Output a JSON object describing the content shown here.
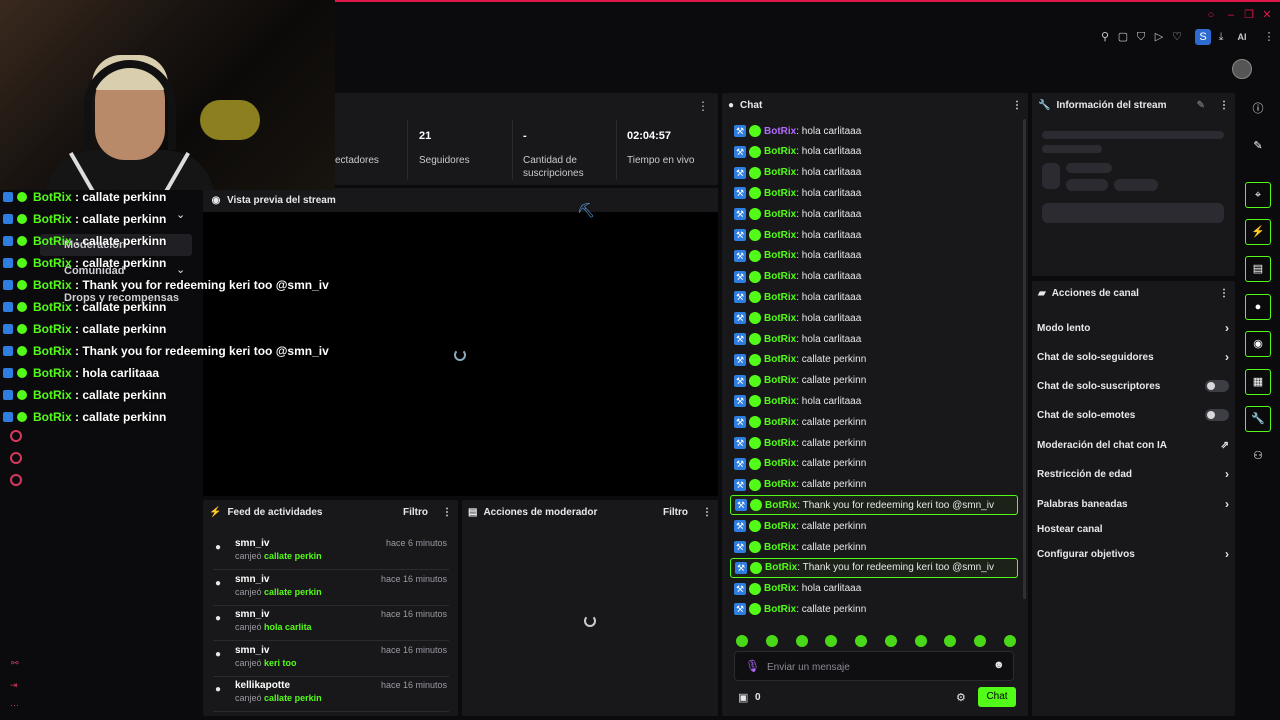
{
  "overlay_chat": [
    {
      "user": "BotRix",
      "text": "callate perkinn"
    },
    {
      "user": "BotRix",
      "text": "callate perkinn"
    },
    {
      "user": "BotRix",
      "text": "callate perkinn"
    },
    {
      "user": "BotRix",
      "text": "callate perkinn"
    },
    {
      "user": "BotRix",
      "text": "Thank you for redeeming keri too @smn_iv"
    },
    {
      "user": "BotRix",
      "text": "callate perkinn"
    },
    {
      "user": "BotRix",
      "text": "callate perkinn"
    },
    {
      "user": "BotRix",
      "text": "Thank you for redeeming keri too @smn_iv"
    },
    {
      "user": "BotRix",
      "text": "hola carlitaaa"
    },
    {
      "user": "BotRix",
      "text": "callate perkinn"
    },
    {
      "user": "BotRix",
      "text": "callate perkinn"
    }
  ],
  "leftnav": {
    "moderation": "Moderación",
    "community": "Comunidad",
    "drops": "Drops y recompensas"
  },
  "stats": {
    "viewers_label": "ectadores",
    "followers_value": "21",
    "followers_label": "Seguidores",
    "subs_value": "-",
    "subs_label": "Cantidad de suscripciones",
    "uptime_value": "02:04:57",
    "uptime_label": "Tiempo en vivo"
  },
  "preview": {
    "title": "Vista previa del stream"
  },
  "feed": {
    "title": "Feed de actividades",
    "filter": "Filtro",
    "items": [
      {
        "user": "smn_iv",
        "time": "hace 6 minutos",
        "verb": "canjeó",
        "reward": "callate perkin"
      },
      {
        "user": "smn_iv",
        "time": "hace 16 minutos",
        "verb": "canjeó",
        "reward": "callate perkin"
      },
      {
        "user": "smn_iv",
        "time": "hace 16 minutos",
        "verb": "canjeó",
        "reward": "hola carlita"
      },
      {
        "user": "smn_iv",
        "time": "hace 16 minutos",
        "verb": "canjeó",
        "reward": "keri too"
      },
      {
        "user": "kellikapotte",
        "time": "hace 16 minutos",
        "verb": "canjeó",
        "reward": "callate perkin"
      }
    ]
  },
  "mod_actions": {
    "title": "Acciones de moderador",
    "filter": "Filtro"
  },
  "chat": {
    "title": "Chat",
    "messages": [
      {
        "user": "BotRix",
        "text": ": hola carlitaaa",
        "hl": false
      },
      {
        "user": "BotRix",
        "text": ": hola carlitaaa",
        "hl": false
      },
      {
        "user": "BotRix",
        "text": ": hola carlitaaa",
        "hl": false
      },
      {
        "user": "BotRix",
        "text": ": hola carlitaaa",
        "hl": false
      },
      {
        "user": "BotRix",
        "text": ": hola carlitaaa",
        "hl": false
      },
      {
        "user": "BotRix",
        "text": ": hola carlitaaa",
        "hl": false
      },
      {
        "user": "BotRix",
        "text": ": hola carlitaaa",
        "hl": false
      },
      {
        "user": "BotRix",
        "text": ": hola carlitaaa",
        "hl": false
      },
      {
        "user": "BotRix",
        "text": ": hola carlitaaa",
        "hl": false
      },
      {
        "user": "BotRix",
        "text": ": hola carlitaaa",
        "hl": false
      },
      {
        "user": "BotRix",
        "text": ": hola carlitaaa",
        "hl": false
      },
      {
        "user": "BotRix",
        "text": ": callate perkinn",
        "hl": false
      },
      {
        "user": "BotRix",
        "text": ": callate perkinn",
        "hl": false
      },
      {
        "user": "BotRix",
        "text": ": hola carlitaaa",
        "hl": false
      },
      {
        "user": "BotRix",
        "text": ": callate perkinn",
        "hl": false
      },
      {
        "user": "BotRix",
        "text": ": callate perkinn",
        "hl": false
      },
      {
        "user": "BotRix",
        "text": ": callate perkinn",
        "hl": false
      },
      {
        "user": "BotRix",
        "text": ": callate perkinn",
        "hl": false
      },
      {
        "user": "BotRix",
        "text": ": Thank you for redeeming keri too @smn_iv",
        "hl": true
      },
      {
        "user": "BotRix",
        "text": ": callate perkinn",
        "hl": false
      },
      {
        "user": "BotRix",
        "text": ": callate perkinn",
        "hl": false
      },
      {
        "user": "BotRix",
        "text": ": Thank you for redeeming keri too @smn_iv",
        "hl": true
      },
      {
        "user": "BotRix",
        "text": ": hola carlitaaa",
        "hl": false
      },
      {
        "user": "BotRix",
        "text": ": callate perkinn",
        "hl": false
      }
    ],
    "input_placeholder": "Enviar un mensaje",
    "points": "0",
    "send_label": "Chat"
  },
  "stream_info": {
    "title": "Información del stream"
  },
  "channel_actions": {
    "title": "Acciones de canal",
    "items": [
      {
        "label": "Modo lento",
        "kind": "chevron"
      },
      {
        "label": "Chat de solo-seguidores",
        "kind": "chevron"
      },
      {
        "label": "Chat de solo-suscriptores",
        "kind": "toggle"
      },
      {
        "label": "Chat de solo-emotes",
        "kind": "toggle"
      },
      {
        "label": "Moderación del chat con IA",
        "kind": "external"
      },
      {
        "label": "Restricción de edad",
        "kind": "chevron"
      },
      {
        "label": "Palabras baneadas",
        "kind": "chevron"
      },
      {
        "label": "Hostear canal",
        "kind": "none"
      },
      {
        "label": "Configurar objetivos",
        "kind": "chevron"
      }
    ]
  },
  "topbar": {
    "profile_letter": "S",
    "ai_label": "AI"
  },
  "colors": {
    "accent": "#53fc18",
    "panel": "#18181b",
    "background": "#0b0b0d",
    "badge": "#2e7de0"
  }
}
